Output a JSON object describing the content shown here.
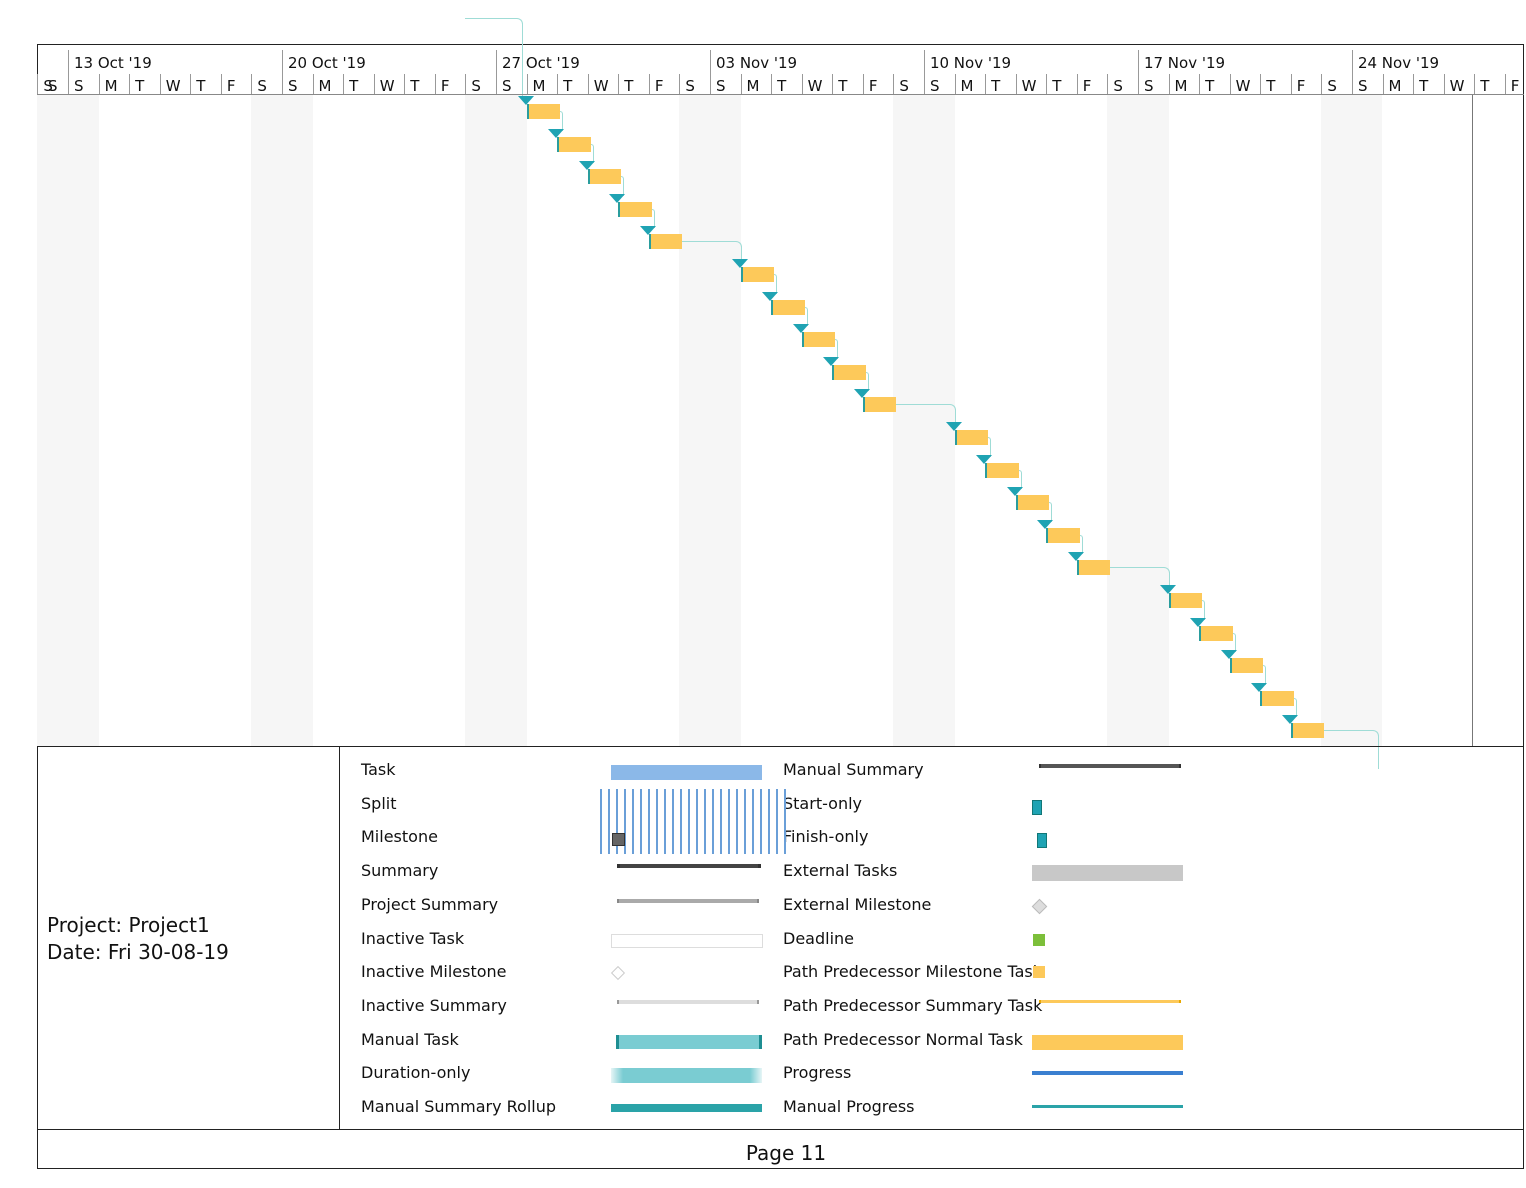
{
  "chart_data": {
    "type": "gantt",
    "timescale_start": "2019-10-12",
    "timescale_end": "2019-11-29",
    "week_labels": [
      "13 Oct '19",
      "20 Oct '19",
      "27 Oct '19",
      "03 Nov '19",
      "10 Nov '19",
      "17 Nov '19",
      "24 Nov '19"
    ],
    "day_letters": [
      "S",
      "S",
      "M",
      "T",
      "W",
      "T",
      "F"
    ],
    "tasks": [
      {
        "start": "2019-10-28",
        "finish": "2019-10-28"
      },
      {
        "start": "2019-10-29",
        "finish": "2019-10-29"
      },
      {
        "start": "2019-10-30",
        "finish": "2019-10-30"
      },
      {
        "start": "2019-10-31",
        "finish": "2019-10-31"
      },
      {
        "start": "2019-11-01",
        "finish": "2019-11-01"
      },
      {
        "start": "2019-11-04",
        "finish": "2019-11-04"
      },
      {
        "start": "2019-11-05",
        "finish": "2019-11-05"
      },
      {
        "start": "2019-11-06",
        "finish": "2019-11-06"
      },
      {
        "start": "2019-11-07",
        "finish": "2019-11-07"
      },
      {
        "start": "2019-11-08",
        "finish": "2019-11-08"
      },
      {
        "start": "2019-11-11",
        "finish": "2019-11-11"
      },
      {
        "start": "2019-11-12",
        "finish": "2019-11-12"
      },
      {
        "start": "2019-11-13",
        "finish": "2019-11-13"
      },
      {
        "start": "2019-11-14",
        "finish": "2019-11-14"
      },
      {
        "start": "2019-11-15",
        "finish": "2019-11-15"
      },
      {
        "start": "2019-11-18",
        "finish": "2019-11-18"
      },
      {
        "start": "2019-11-19",
        "finish": "2019-11-19"
      },
      {
        "start": "2019-11-20",
        "finish": "2019-11-20"
      },
      {
        "start": "2019-11-21",
        "finish": "2019-11-21"
      },
      {
        "start": "2019-11-22",
        "finish": "2019-11-22"
      }
    ],
    "bar_color": "#fdc95a",
    "link_color": "#1fa3b3",
    "weekend_shading": "#f6f6f6"
  },
  "project": {
    "name": "Project: Project1",
    "date": "Date: Fri 30-08-19"
  },
  "legend": {
    "left": [
      "Task",
      "Split",
      "Milestone",
      "Summary",
      "Project Summary",
      "Inactive Task",
      "Inactive Milestone",
      "Inactive Summary",
      "Manual Task",
      "Duration-only",
      "Manual Summary Rollup"
    ],
    "right": [
      "Manual Summary",
      "Start-only",
      "Finish-only",
      "External Tasks",
      "External Milestone",
      "Deadline",
      "Path Predecessor Milestone Task",
      "Path Predecessor Summary Task",
      "Path Predecessor Normal Task",
      "Progress",
      "Manual Progress"
    ]
  },
  "footer": {
    "page": "Page 11"
  }
}
